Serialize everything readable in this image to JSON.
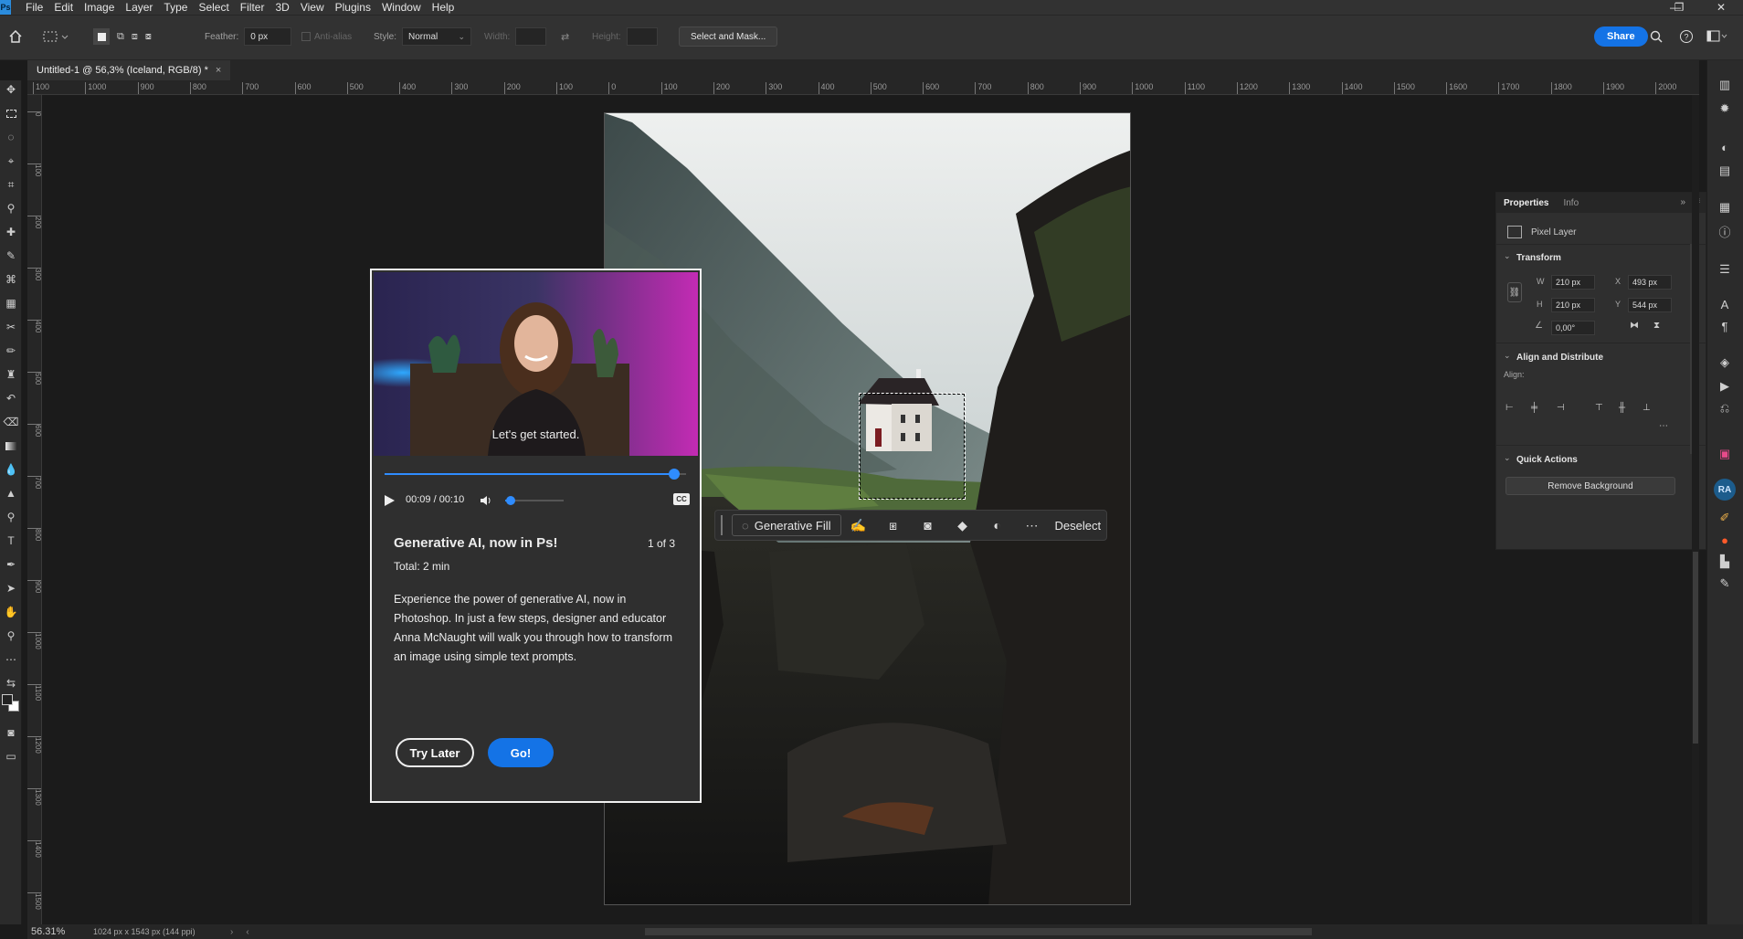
{
  "menu": {
    "logo": "Ps",
    "items": [
      "File",
      "Edit",
      "Image",
      "Layer",
      "Type",
      "Select",
      "Filter",
      "3D",
      "View",
      "Plugins",
      "Window",
      "Help"
    ]
  },
  "window_controls": {
    "minimize": "—",
    "maximize": "❐",
    "close": "✕"
  },
  "options_bar": {
    "feather_label": "Feather:",
    "feather_value": "0 px",
    "antialias_label": "Anti-alias",
    "style_label": "Style:",
    "style_value": "Normal",
    "width_label": "Width:",
    "height_label": "Height:",
    "select_mask_label": "Select and Mask...",
    "share_label": "Share"
  },
  "document": {
    "tab_title": "Untitled-1 @ 56,3% (Iceland, RGB/8) *",
    "close_glyph": "×"
  },
  "ruler": {
    "h_ticks": [
      "100",
      "1000",
      "900",
      "800",
      "700",
      "600",
      "500",
      "400",
      "300",
      "200",
      "100",
      "0",
      "100",
      "200",
      "300",
      "400",
      "500",
      "600",
      "700",
      "800",
      "900",
      "1000",
      "1100",
      "1200",
      "1300",
      "1400",
      "1500",
      "1600",
      "1700",
      "1800",
      "1900",
      "2000"
    ],
    "v_ticks": [
      "0",
      "1 0 0",
      "2 0 0",
      "3 0 0",
      "4 0 0",
      "5 0 0",
      "6 0 0",
      "7 0 0",
      "8 0 0",
      "9 0 0",
      "1 0 0 0",
      "1 1 0 0",
      "1 2 0 0",
      "1 3 0 0",
      "1 4 0 0",
      "1 5 0 0"
    ]
  },
  "contextual_bar": {
    "generative_fill": "Generative Fill",
    "deselect": "Deselect"
  },
  "modal": {
    "video_caption": "Let's get started.",
    "time": "00:09 / 00:10",
    "progress_fraction": 0.96,
    "volume_fraction": 0.1,
    "cc_label": "CC",
    "title": "Generative AI, now in Ps!",
    "pager": "1 of 3",
    "total": "Total: 2 min",
    "body": "Experience the power of generative AI, now in Photoshop. In just a few steps, designer and educator Anna McNaught will walk you through how to transform an image using simple text prompts.",
    "try_later": "Try Later",
    "go": "Go!"
  },
  "properties_panel": {
    "tab_properties": "Properties",
    "tab_info": "Info",
    "layer_type": "Pixel Layer",
    "transform_title": "Transform",
    "w_label": "W",
    "w_value": "210 px",
    "h_label": "H",
    "h_value": "210 px",
    "x_label": "X",
    "x_value": "493 px",
    "y_label": "Y",
    "y_value": "544 px",
    "angle_value": "0,00°",
    "align_title": "Align and Distribute",
    "align_label": "Align:",
    "quick_actions_title": "Quick Actions",
    "remove_bg": "Remove Background"
  },
  "status": {
    "zoom": "56.31%",
    "doc_info": "1024 px x 1543 px (144 ppi)"
  },
  "colors": {
    "accent": "#1473e6",
    "panel": "#323232",
    "canvas_bg": "#1b1b1b"
  }
}
